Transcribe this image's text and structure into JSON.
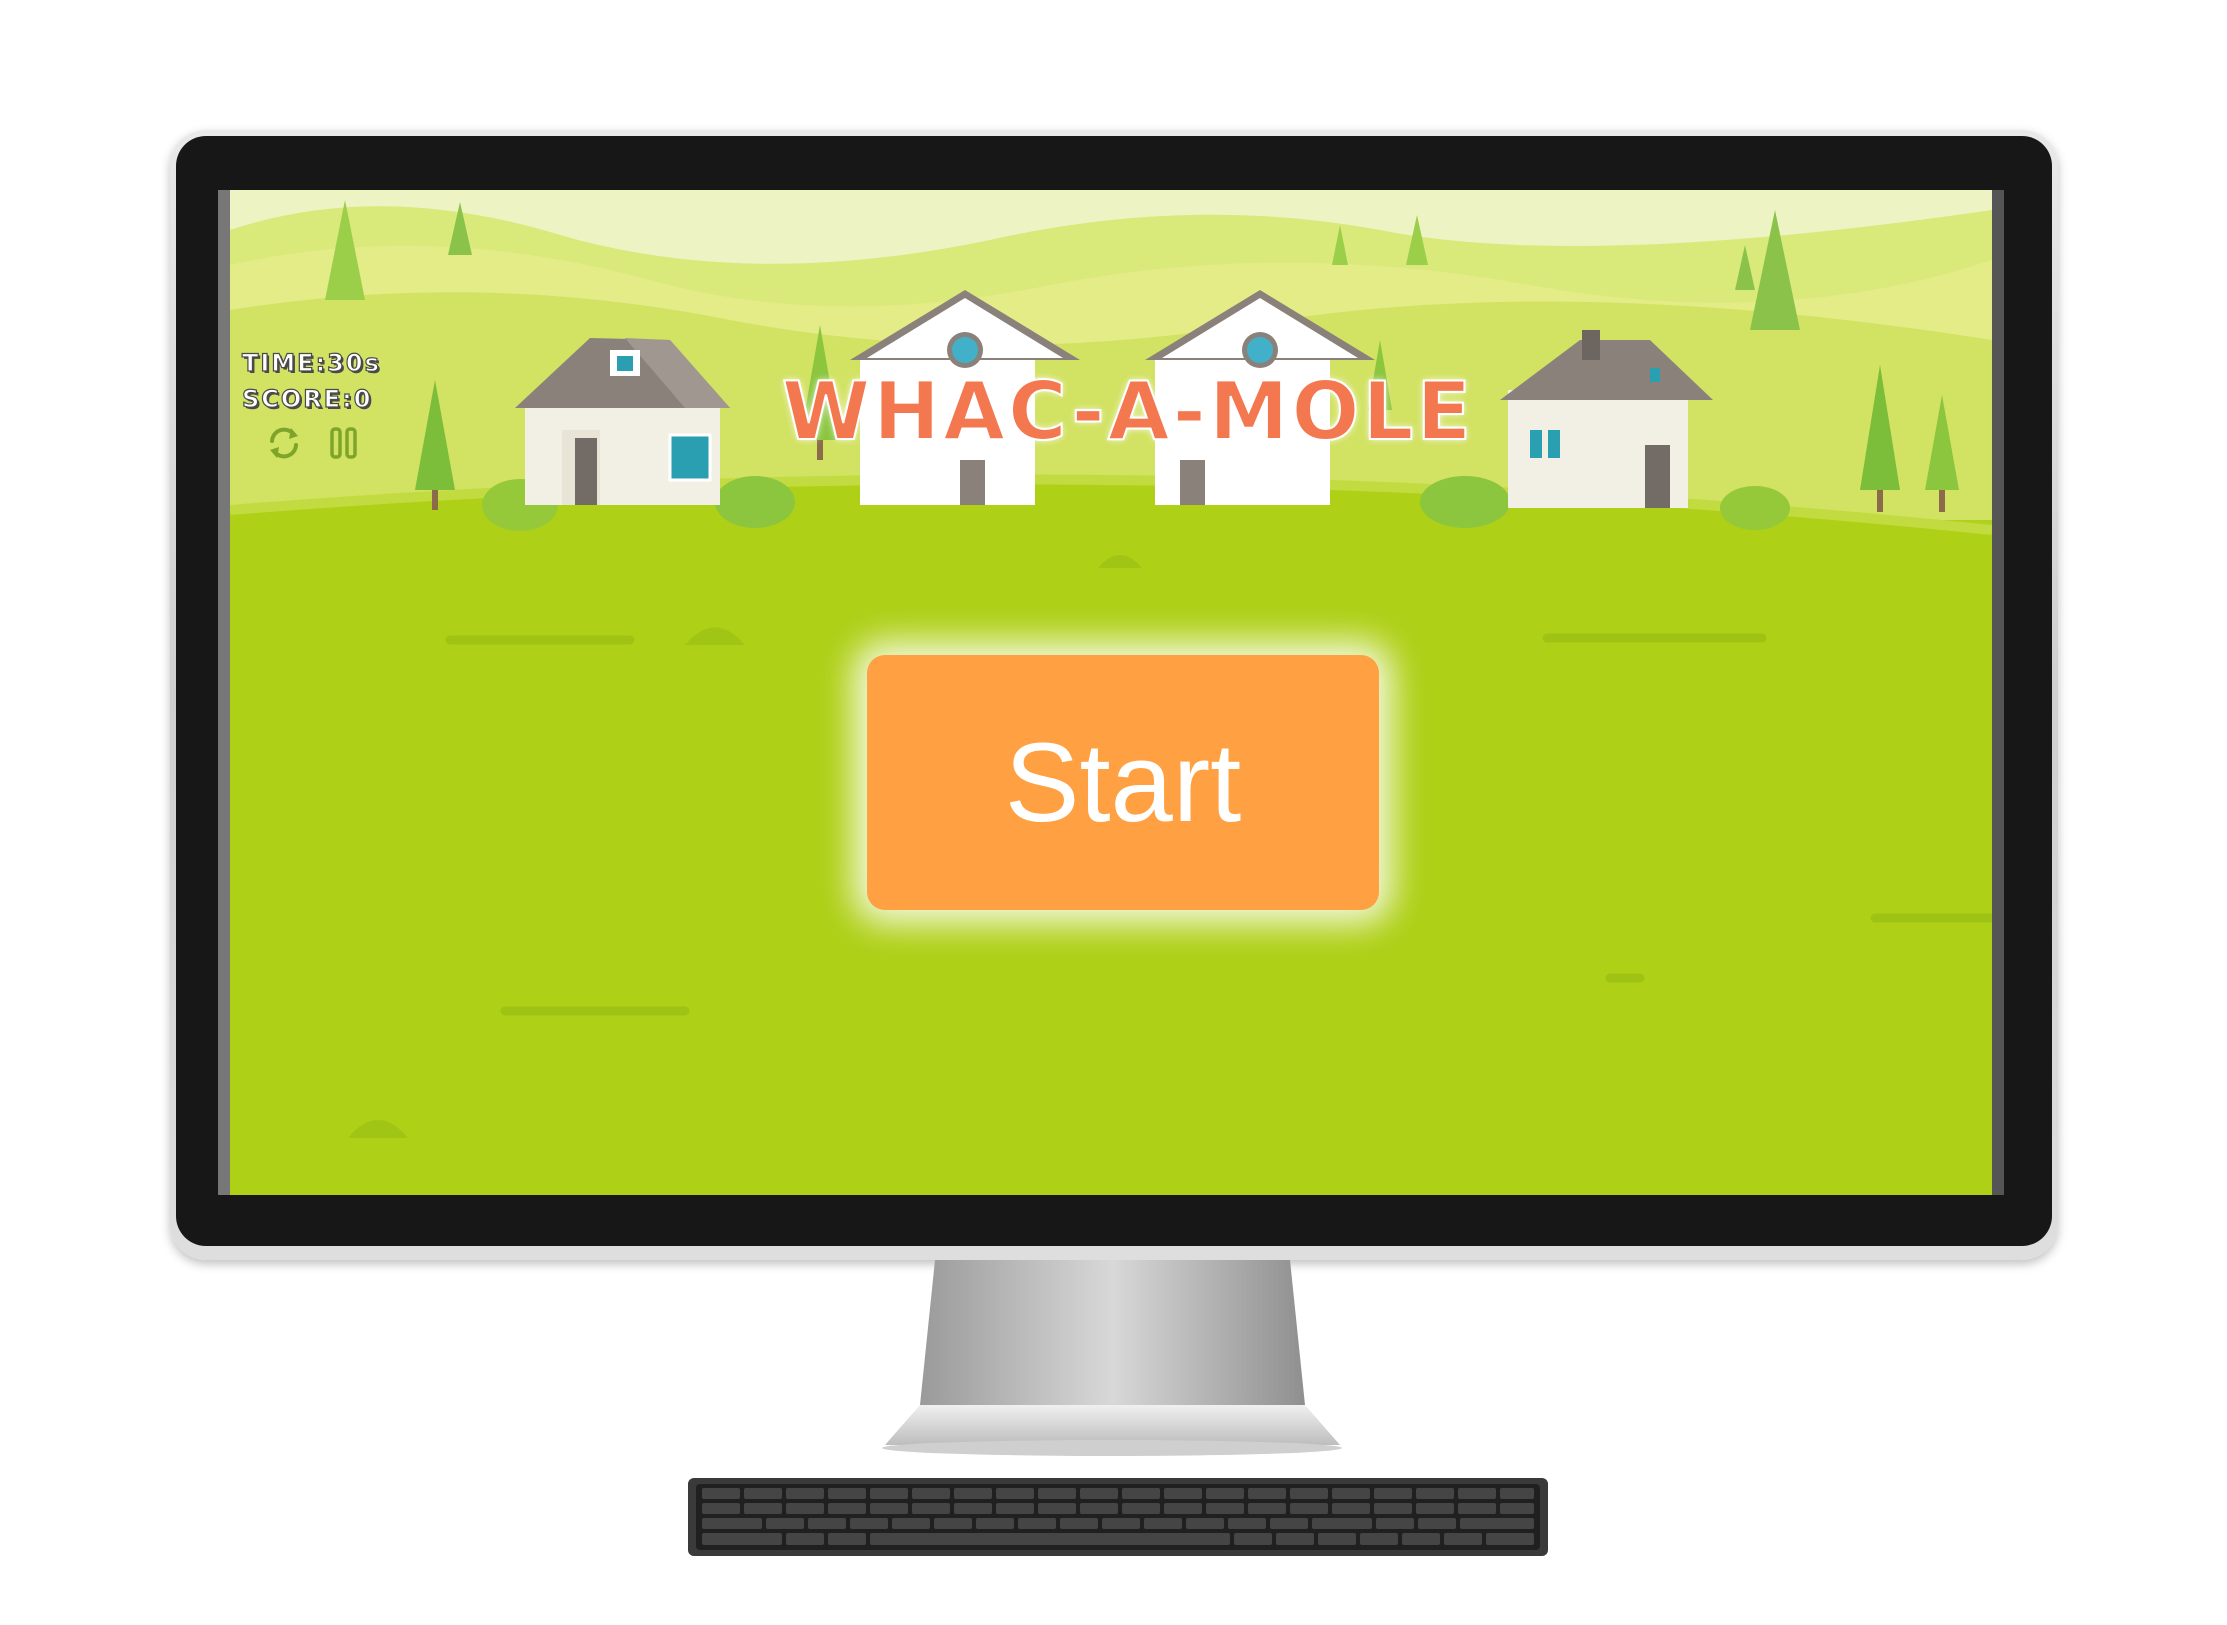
{
  "game": {
    "title": "WHAC-A-MOLE",
    "hud": {
      "time_label": "TIME:30s",
      "score_label": "SCORE:0"
    },
    "controls": {
      "restart_icon": "refresh-icon",
      "pause_icon": "pause-icon"
    },
    "start_label": "Start"
  },
  "colors": {
    "grass": "#b3d51d",
    "title": "#f37850",
    "start_button": "#ffa042"
  }
}
